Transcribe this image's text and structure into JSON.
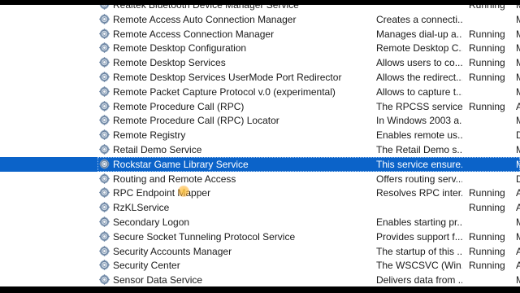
{
  "services": [
    {
      "name": "Realtek Bluetooth Device Manager Service",
      "description": "",
      "status": "Running",
      "startup_fragment": "M"
    },
    {
      "name": "Remote Access Auto Connection Manager",
      "description": "Creates a connecti...",
      "status": "",
      "startup_fragment": "M"
    },
    {
      "name": "Remote Access Connection Manager",
      "description": "Manages dial-up a...",
      "status": "Running",
      "startup_fragment": "M"
    },
    {
      "name": "Remote Desktop Configuration",
      "description": "Remote Desktop C...",
      "status": "Running",
      "startup_fragment": "M"
    },
    {
      "name": "Remote Desktop Services",
      "description": "Allows users to co...",
      "status": "Running",
      "startup_fragment": "M"
    },
    {
      "name": "Remote Desktop Services UserMode Port Redirector",
      "description": "Allows the redirect...",
      "status": "Running",
      "startup_fragment": "M"
    },
    {
      "name": "Remote Packet Capture Protocol v.0 (experimental)",
      "description": "Allows to capture t...",
      "status": "",
      "startup_fragment": "M"
    },
    {
      "name": "Remote Procedure Call (RPC)",
      "description": "The RPCSS service ...",
      "status": "Running",
      "startup_fragment": "A"
    },
    {
      "name": "Remote Procedure Call (RPC) Locator",
      "description": "In Windows 2003 a...",
      "status": "",
      "startup_fragment": "M"
    },
    {
      "name": "Remote Registry",
      "description": "Enables remote us...",
      "status": "",
      "startup_fragment": "D"
    },
    {
      "name": "Retail Demo Service",
      "description": "The Retail Demo s...",
      "status": "",
      "startup_fragment": "M"
    },
    {
      "name": "Rockstar Game Library Service",
      "description": "This service ensure...",
      "status": "",
      "startup_fragment": "M"
    },
    {
      "name": "Routing and Remote Access",
      "description": "Offers routing serv...",
      "status": "",
      "startup_fragment": "D"
    },
    {
      "name": "RPC Endpoint Mapper",
      "description": "Resolves RPC inter...",
      "status": "Running",
      "startup_fragment": "A"
    },
    {
      "name": "RzKLService",
      "description": "",
      "status": "Running",
      "startup_fragment": "A"
    },
    {
      "name": "Secondary Logon",
      "description": "Enables starting pr...",
      "status": "",
      "startup_fragment": "M"
    },
    {
      "name": "Secure Socket Tunneling Protocol Service",
      "description": "Provides support f...",
      "status": "Running",
      "startup_fragment": "M"
    },
    {
      "name": "Security Accounts Manager",
      "description": "The startup of this ...",
      "status": "Running",
      "startup_fragment": "A"
    },
    {
      "name": "Security Center",
      "description": "The WSCSVC (Win...",
      "status": "Running",
      "startup_fragment": "A"
    },
    {
      "name": "Sensor Data Service",
      "description": "Delivers data from ...",
      "status": "",
      "startup_fragment": "M"
    }
  ],
  "selected_index": 11,
  "colors": {
    "selection": "#0b63c9",
    "text": "#1a1a1a",
    "cursor_highlight": "#ffb428"
  },
  "icon_name": "gear-icon"
}
